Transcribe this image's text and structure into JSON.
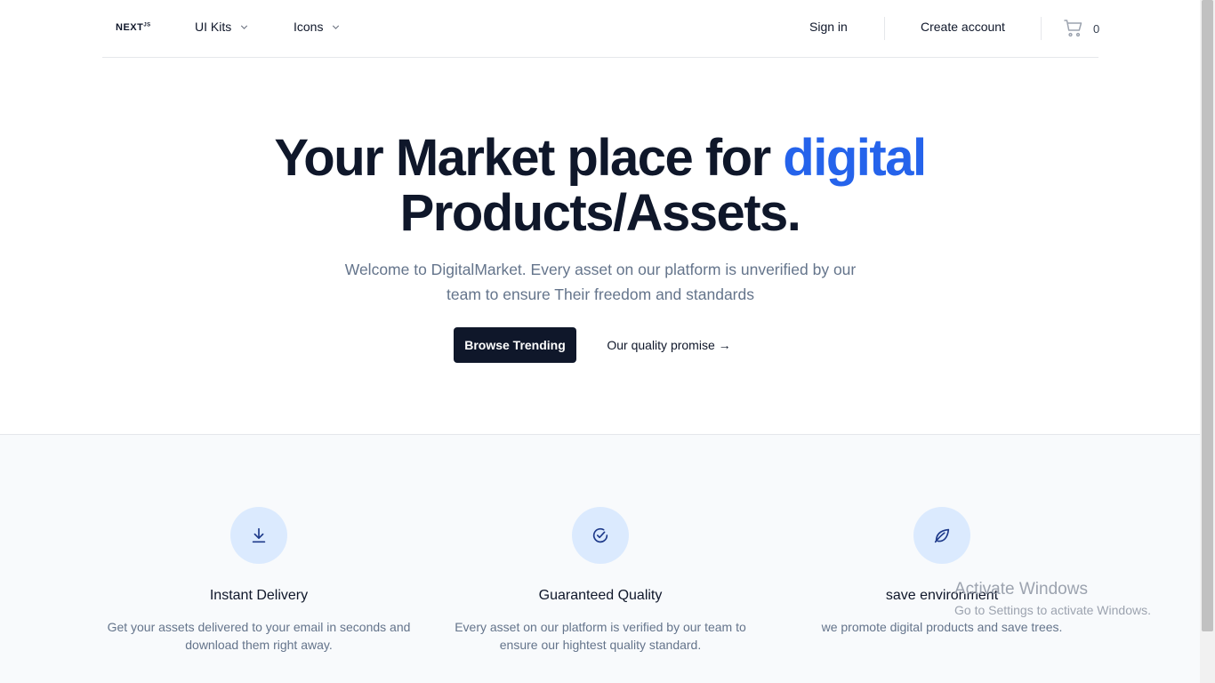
{
  "header": {
    "logo": "NEXT",
    "logo_suffix": "JS",
    "nav": [
      {
        "label": "UI Kits"
      },
      {
        "label": "Icons"
      }
    ],
    "sign_in": "Sign in",
    "create_account": "Create account",
    "cart_count": "0"
  },
  "hero": {
    "title_main": "Your Market place for ",
    "title_accent": "digital",
    "title_line2": "Products/Assets.",
    "subtitle": "Welcome to DigitalMarket. Every asset on our platform is unverified by our team to ensure Their freedom and standards",
    "primary_button": "Browse Trending",
    "secondary_button": "Our quality promise →"
  },
  "features": [
    {
      "icon": "download-icon",
      "title": "Instant Delivery",
      "description": "Get your assets delivered to your email in seconds and download them right away."
    },
    {
      "icon": "check-circle-icon",
      "title": "Guaranteed Quality",
      "description": "Every asset on our platform is verified by our team to ensure our hightest quality standard."
    },
    {
      "icon": "leaf-icon",
      "title": "save environment",
      "description": "we promote digital products and save trees."
    }
  ],
  "watermark": {
    "title": "Activate Windows",
    "subtitle": "Go to Settings to activate Windows."
  },
  "colors": {
    "accent": "#2563eb",
    "dark": "#0f172a",
    "muted": "#64748b",
    "icon_bg": "#dbeafe"
  }
}
